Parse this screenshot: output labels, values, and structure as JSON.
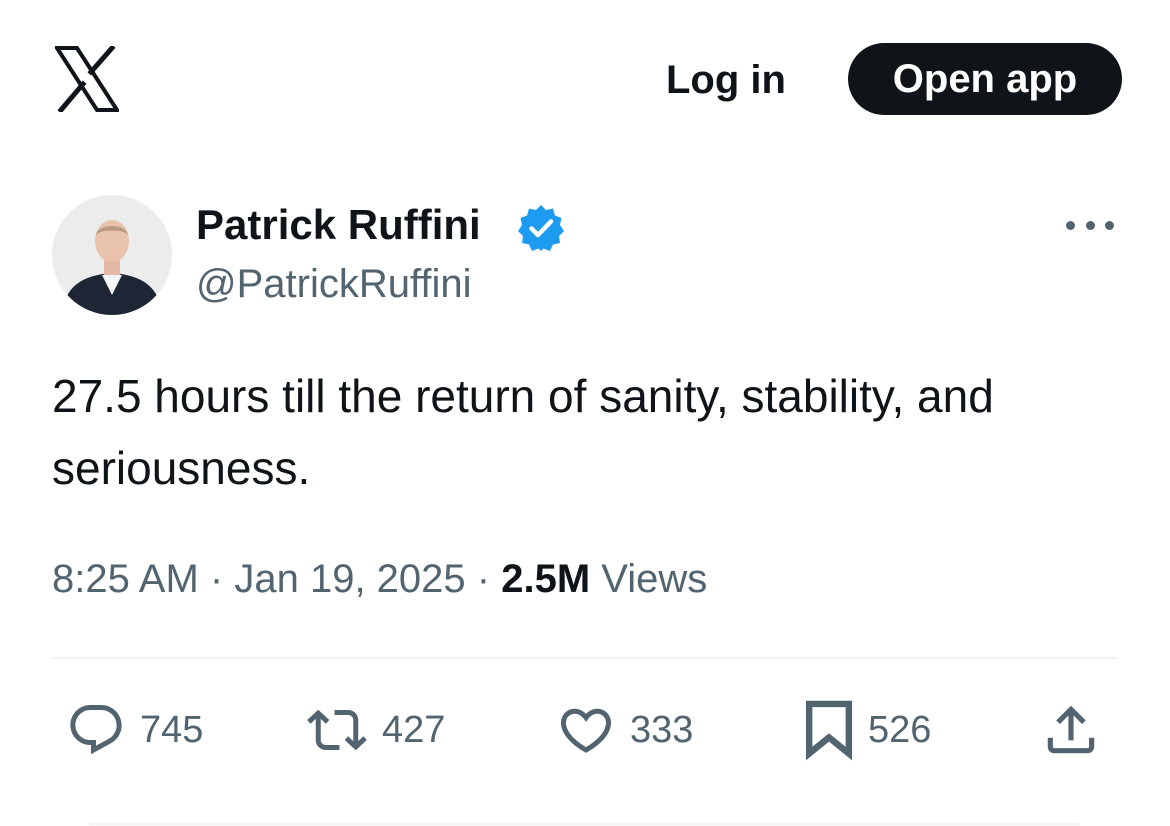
{
  "header": {
    "logo_icon": "x-logo-icon",
    "login_label": "Log in",
    "open_app_label": "Open app"
  },
  "author": {
    "name": "Patrick Ruffini",
    "handle": "@PatrickRuffini",
    "verified": true,
    "verified_color": "#1d9bf0"
  },
  "tweet": {
    "text": "27.5 hours till the return of sanity, stability, and seriousness.",
    "time": "8:25 AM",
    "date": "Jan 19, 2025",
    "separator": "·",
    "views_count": "2.5M",
    "views_label": "Views"
  },
  "actions": {
    "reply": {
      "icon": "reply-icon",
      "count": "745"
    },
    "repost": {
      "icon": "repost-icon",
      "count": "427"
    },
    "like": {
      "icon": "heart-icon",
      "count": "333"
    },
    "bookmark": {
      "icon": "bookmark-icon",
      "count": "526"
    },
    "share": {
      "icon": "share-icon"
    }
  },
  "colors": {
    "text": "#0f1419",
    "secondary": "#536471",
    "accent": "#1d9bf0",
    "button_bg": "#0f1419"
  }
}
